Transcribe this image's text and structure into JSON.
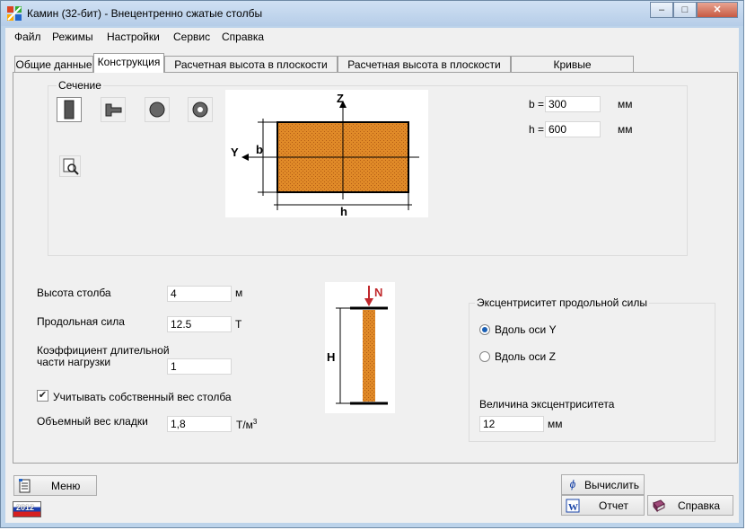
{
  "window": {
    "title": "Камин (32-бит) - Внецентренно сжатые столбы",
    "minimize": "–",
    "maximize": "□",
    "close": "✕"
  },
  "menu": {
    "file": "Файл",
    "modes": "Режимы",
    "settings": "Настройки",
    "service": "Сервис",
    "help": "Справка"
  },
  "tabs": {
    "general": "Общие данные",
    "construction": "Конструкция",
    "height_xoy": "Расчетная высота в плоскости XoY",
    "height_xoz": "Расчетная высота в плоскости XoZ",
    "interaction": "Кривые взаимодействия"
  },
  "section": {
    "legend": "Сечение",
    "shapes": [
      "rectangle-icon",
      "t-section-icon",
      "circle-icon",
      "ring-icon"
    ],
    "selected_shape": "rectangle-icon",
    "diagram": {
      "z": "Z",
      "y": "Y",
      "b": "b",
      "h": "h"
    },
    "b_label": "b =",
    "b_value": "300",
    "b_unit": "мм",
    "h_label": "h =",
    "h_value": "600",
    "h_unit": "мм"
  },
  "column": {
    "height_label": "Высота столба",
    "height_value": "4",
    "height_unit": "м",
    "force_label": "Продольная сила",
    "force_value": "12.5",
    "force_unit": "Т",
    "coef_label_1": "Коэффициент длительной",
    "coef_label_2": "части нагрузки",
    "coef_value": "1",
    "self_weight_checked": true,
    "self_weight_label": "Учитывать собственный вес столба",
    "vol_weight_label": "Объемный вес кладки",
    "vol_weight_value": "1,8",
    "vol_weight_unit": "Т/м",
    "vol_weight_sup": "3",
    "diagram": {
      "n": "N",
      "h": "H"
    }
  },
  "eccentricity": {
    "legend": "Эксцентриситет продольной силы",
    "option_y": "Вдоль оси Y",
    "option_z": "Вдоль оси Z",
    "selected": "y",
    "value_label": "Величина эксцентриситета",
    "value": "12",
    "unit": "мм"
  },
  "buttons": {
    "menu": "Меню",
    "calculate": "Вычислить",
    "report": "Отчет",
    "help": "Справка"
  },
  "badge": "2012",
  "colors": {
    "masonry": "#e08a28",
    "accent_arrow": "#c0282c",
    "title_bg": "#bcd3ea"
  }
}
